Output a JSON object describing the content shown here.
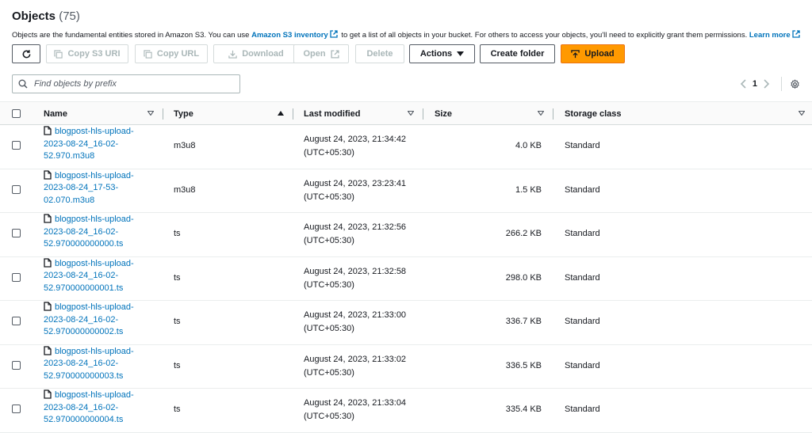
{
  "header": {
    "title": "Objects",
    "count": "(75)",
    "desc_before": "Objects are the fundamental entities stored in Amazon S3. You can use ",
    "desc_link1": "Amazon S3 inventory",
    "desc_middle": " to get a list of all objects in your bucket. For others to access your objects, you'll need to explicitly grant them permissions. ",
    "desc_link2": "Learn more"
  },
  "toolbar": {
    "copy_s3_uri": "Copy S3 URI",
    "copy_url": "Copy URL",
    "download": "Download",
    "open": "Open",
    "delete": "Delete",
    "actions": "Actions",
    "create_folder": "Create folder",
    "upload": "Upload"
  },
  "search": {
    "placeholder": "Find objects by prefix"
  },
  "pagination": {
    "page": "1"
  },
  "columns": {
    "name": "Name",
    "type": "Type",
    "last_modified": "Last modified",
    "size": "Size",
    "storage_class": "Storage class"
  },
  "rows": [
    {
      "name": [
        "blogpost-hls-upload-",
        "2023-08-24_16-02-",
        "52.970.m3u8"
      ],
      "type": "m3u8",
      "modified": [
        "August 24, 2023, 21:34:42",
        "(UTC+05:30)"
      ],
      "size": "4.0 KB",
      "storage_class": "Standard"
    },
    {
      "name": [
        "blogpost-hls-upload-",
        "2023-08-24_17-53-",
        "02.070.m3u8"
      ],
      "type": "m3u8",
      "modified": [
        "August 24, 2023, 23:23:41",
        "(UTC+05:30)"
      ],
      "size": "1.5 KB",
      "storage_class": "Standard"
    },
    {
      "name": [
        "blogpost-hls-upload-",
        "2023-08-24_16-02-",
        "52.970000000000.ts"
      ],
      "type": "ts",
      "modified": [
        "August 24, 2023, 21:32:56",
        "(UTC+05:30)"
      ],
      "size": "266.2 KB",
      "storage_class": "Standard"
    },
    {
      "name": [
        "blogpost-hls-upload-",
        "2023-08-24_16-02-",
        "52.970000000001.ts"
      ],
      "type": "ts",
      "modified": [
        "August 24, 2023, 21:32:58",
        "(UTC+05:30)"
      ],
      "size": "298.0 KB",
      "storage_class": "Standard"
    },
    {
      "name": [
        "blogpost-hls-upload-",
        "2023-08-24_16-02-",
        "52.970000000002.ts"
      ],
      "type": "ts",
      "modified": [
        "August 24, 2023, 21:33:00",
        "(UTC+05:30)"
      ],
      "size": "336.7 KB",
      "storage_class": "Standard"
    },
    {
      "name": [
        "blogpost-hls-upload-",
        "2023-08-24_16-02-",
        "52.970000000003.ts"
      ],
      "type": "ts",
      "modified": [
        "August 24, 2023, 21:33:02",
        "(UTC+05:30)"
      ],
      "size": "336.5 KB",
      "storage_class": "Standard"
    },
    {
      "name": [
        "blogpost-hls-upload-",
        "2023-08-24_16-02-",
        "52.970000000004.ts"
      ],
      "type": "ts",
      "modified": [
        "August 24, 2023, 21:33:04",
        "(UTC+05:30)"
      ],
      "size": "335.4 KB",
      "storage_class": "Standard"
    }
  ],
  "colors": {
    "link": "#0073bb",
    "primary": "#ff9900",
    "text": "#16191f",
    "disabled": "#aab7b8"
  }
}
